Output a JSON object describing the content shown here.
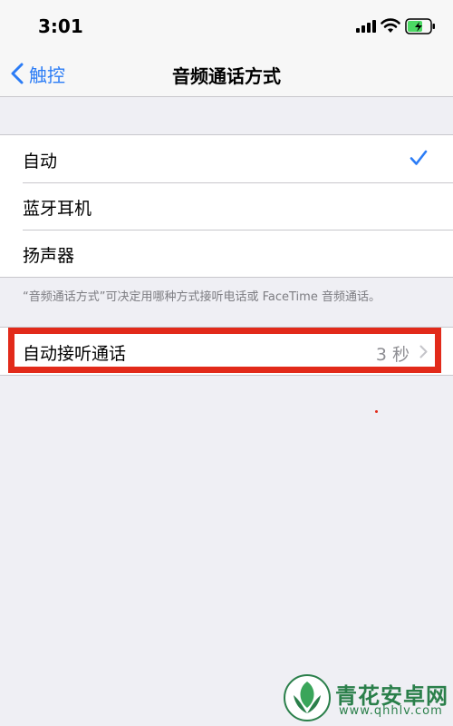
{
  "status_bar": {
    "time": "3:01"
  },
  "nav": {
    "back_label": "触控",
    "title": "音频通话方式"
  },
  "audio_options": {
    "items": [
      {
        "label": "自动",
        "selected": true
      },
      {
        "label": "蓝牙耳机",
        "selected": false
      },
      {
        "label": "扬声器",
        "selected": false
      }
    ],
    "footer": "“音频通话方式”可决定用哪种方式接听电话或 FaceTime 音频通话。"
  },
  "auto_answer": {
    "label": "自动接听通话",
    "value": "3 秒"
  },
  "watermark": {
    "title": "青花安卓网",
    "url": "www.qhhlv.com"
  },
  "colors": {
    "accent": "#2b7cf6",
    "highlight": "#e22a1a",
    "background": "#efeff4",
    "battery_green": "#4cd964"
  },
  "icons": [
    "signal-icon",
    "wifi-icon",
    "battery-icon",
    "back-chevron-icon",
    "check-icon",
    "chevron-right-icon",
    "logo-icon"
  ]
}
